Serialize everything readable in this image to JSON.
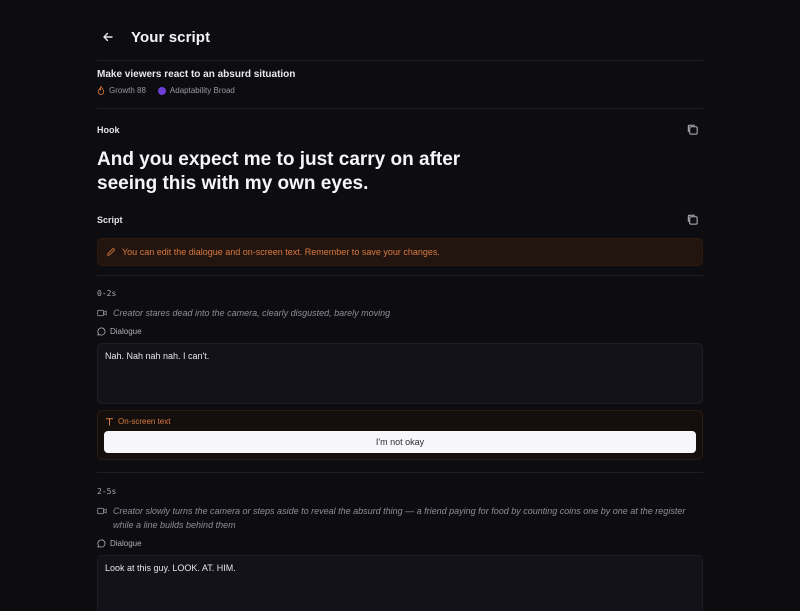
{
  "header": {
    "title": "Your script"
  },
  "idea": {
    "title": "Make viewers react to an absurd situation",
    "growth": "Growth 88",
    "adaptability": "Adaptability Broad"
  },
  "hook": {
    "label": "Hook",
    "text": "And you expect me to just carry on after seeing this with my own eyes."
  },
  "script": {
    "label": "Script",
    "notice": "You can edit the dialogue and on-screen text. Remember to save your changes.",
    "segments": [
      {
        "time": "0-2s",
        "action": "Creator stares dead into the camera, clearly disgusted, barely moving",
        "dialogue_label": "Dialogue",
        "dialogue": "Nah. Nah nah nah. I can't.",
        "ost_label": "On-screen text",
        "ost": "I'm not okay"
      },
      {
        "time": "2-5s",
        "action": "Creator slowly turns the camera or steps aside to reveal the absurd thing — a friend paying for food by counting coins one by one at the register while a line builds behind them",
        "dialogue_label": "Dialogue",
        "dialogue": "Look at this guy. LOOK. AT. HIM."
      }
    ]
  },
  "colors": {
    "background": "#0d0c10",
    "accent_orange": "#d9793f",
    "purple_dot": "#6d3fd6"
  }
}
